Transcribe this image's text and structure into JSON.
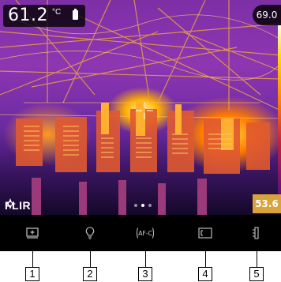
{
  "overlay": {
    "spot_temperature": "61.2",
    "temperature_unit": "°C",
    "scale_max": "69.0",
    "scale_min": "53.6",
    "brand": "FLIR"
  },
  "pager": {
    "count": 3,
    "active_index": 1
  },
  "toolbar": {
    "items": [
      {
        "icon": "image-mode-icon"
      },
      {
        "icon": "lightbulb-icon"
      },
      {
        "icon": "autofocus-icon",
        "label": "AF-C"
      },
      {
        "icon": "measurement-frame-icon"
      },
      {
        "icon": "color-scale-icon"
      }
    ]
  },
  "callouts": [
    "1",
    "2",
    "3",
    "4",
    "5"
  ],
  "colors": {
    "toolbar_bg": "#000000",
    "thermal_hot": "#ffd23a",
    "thermal_cold": "#5a1080",
    "scale_min_bg": "#d8a23c"
  }
}
